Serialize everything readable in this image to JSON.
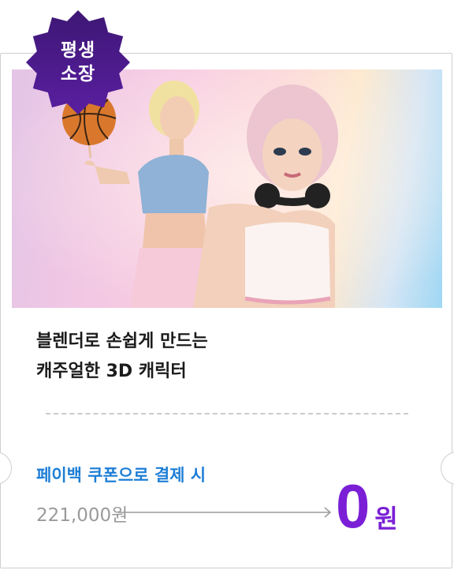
{
  "badge": {
    "line1": "평생",
    "line2": "소장"
  },
  "product": {
    "title_line1": "블렌더로 손쉽게 만드는",
    "title_line2": "캐주얼한 3D 캐릭터"
  },
  "payback": {
    "label": "페이백 쿠폰으로 결제 시"
  },
  "price": {
    "original": "221,000원",
    "final_amount": "0",
    "final_unit": "원"
  },
  "colors": {
    "badge": "#4b1a8c",
    "accent_blue": "#1e7ed6",
    "accent_purple": "#7a1fd6"
  }
}
